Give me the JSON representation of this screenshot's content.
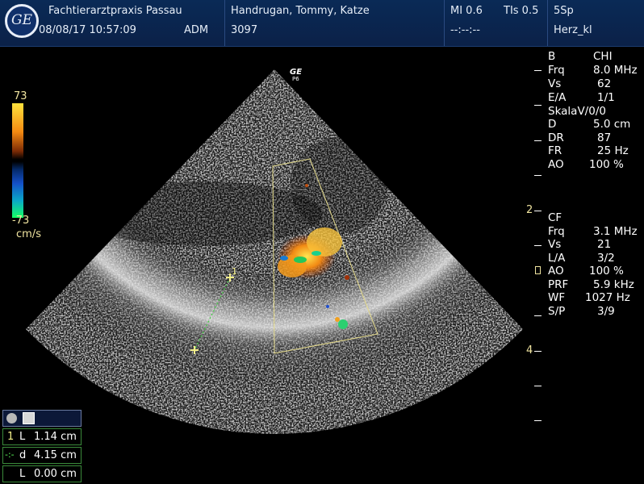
{
  "header": {
    "clinic": "Fachtierarztpraxis Passau",
    "datetime": "08/08/17 10:57:09",
    "operator": "ADM",
    "patient": "Handrugan, Tommy, Katze",
    "patient_id": "3097",
    "mi": "MI 0.6",
    "tis": "TIs 0.5",
    "probe": "5Sp",
    "time_field": "--:--:--",
    "preset": "Herz_kl"
  },
  "probe_mark": {
    "brand": "GE",
    "model": "P6"
  },
  "color_scale": {
    "max": "73",
    "min": "-73",
    "unit": "cm/s"
  },
  "bmode_params": [
    {
      "label": "B",
      "value": "CHI"
    },
    {
      "label": "Frq",
      "value": "8.0 MHz"
    },
    {
      "label": "Vs",
      "value": "62"
    },
    {
      "label": "E/A",
      "value": "1/1"
    },
    {
      "label": "SkalaV/0/0",
      "value": ""
    },
    {
      "label": "D",
      "value": "5.0 cm"
    },
    {
      "label": "DR",
      "value": "87"
    },
    {
      "label": "FR",
      "value": "25 Hz"
    },
    {
      "label": "AO",
      "value": "100 %"
    }
  ],
  "cf_params": [
    {
      "label": "CF",
      "value": ""
    },
    {
      "label": "Frq",
      "value": "3.1 MHz"
    },
    {
      "label": "Vs",
      "value": "21"
    },
    {
      "label": "L/A",
      "value": "3/2"
    },
    {
      "label": "AO",
      "value": "100 %"
    },
    {
      "label": "PRF",
      "value": "5.9 kHz"
    },
    {
      "label": "WF",
      "value": "1027 Hz"
    },
    {
      "label": "S/P",
      "value": "3/9"
    }
  ],
  "depth_scale": {
    "marks": [
      "2",
      "4"
    ]
  },
  "caliper": {
    "label": "1"
  },
  "measurements": [
    {
      "index": "1",
      "name": "L",
      "value": "1.14 cm"
    },
    {
      "index": "-:-",
      "name": "d",
      "value": "4.15 cm"
    },
    {
      "index": "",
      "name": "L",
      "value": "0.00 cm"
    }
  ],
  "colors": {
    "header_bg": "#0b2148",
    "caliper": "#f5f08a",
    "measure_green": "#5cff5c",
    "sector_box": "#e6dc8c"
  }
}
